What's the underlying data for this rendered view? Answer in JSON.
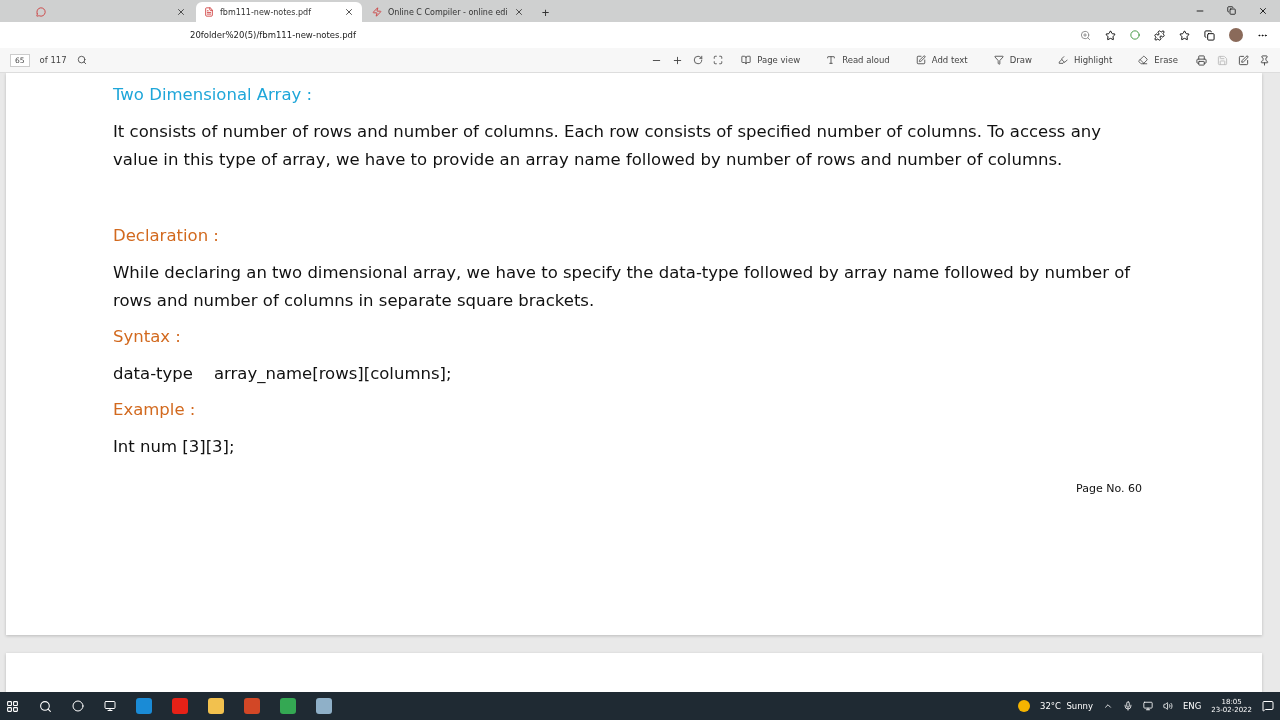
{
  "tabs": [
    {
      "selected": false,
      "kind": "chat"
    },
    {
      "title": "fbm111-new-notes.pdf",
      "selected": true,
      "kind": "pdf"
    },
    {
      "title": "Online C Compiler - online edi",
      "selected": false,
      "kind": "code"
    }
  ],
  "new_tab": "+",
  "address": "20folder%20(5)/fbm111-new-notes.pdf",
  "pdf_toolbar": {
    "page": "65",
    "of": "of 117",
    "tools": [
      {
        "label": "Page view",
        "kind": "page"
      },
      {
        "label": "Read aloud",
        "kind": "read"
      },
      {
        "label": "Add text",
        "kind": "text"
      },
      {
        "label": "Draw",
        "kind": "draw"
      },
      {
        "label": "Highlight",
        "kind": "highlight"
      },
      {
        "label": "Erase",
        "kind": "erase"
      }
    ]
  },
  "document": [
    {
      "kind": "heading",
      "color": "#1ea6d9",
      "text": "Two Dimensional Array :"
    },
    {
      "kind": "para",
      "text": "It consists of number of rows and number of columns. Each row consists of specified number of columns. To access any value in this type of array, we have to provide an array name followed by number of rows and number of columns."
    },
    {
      "kind": "gap"
    },
    {
      "kind": "heading",
      "color": "#d2691e",
      "text": "Declaration :"
    },
    {
      "kind": "para",
      "text": "While declaring an two dimensional array, we have to specify the data-type followed by array name followed by number of rows and number of columns in separate square brackets."
    },
    {
      "kind": "heading",
      "color": "#d2691e",
      "text": "Syntax :"
    },
    {
      "kind": "para",
      "text": "data-type    array_name[rows][columns];"
    },
    {
      "kind": "heading",
      "color": "#d2691e",
      "text": "Example :"
    },
    {
      "kind": "para",
      "text": "Int num [3][3];"
    }
  ],
  "page_number": "Page No. 60",
  "taskbar": {
    "weather": "32°C  Sunny",
    "lang": "ENG",
    "time": "18:05",
    "date": "23-02-2022"
  }
}
